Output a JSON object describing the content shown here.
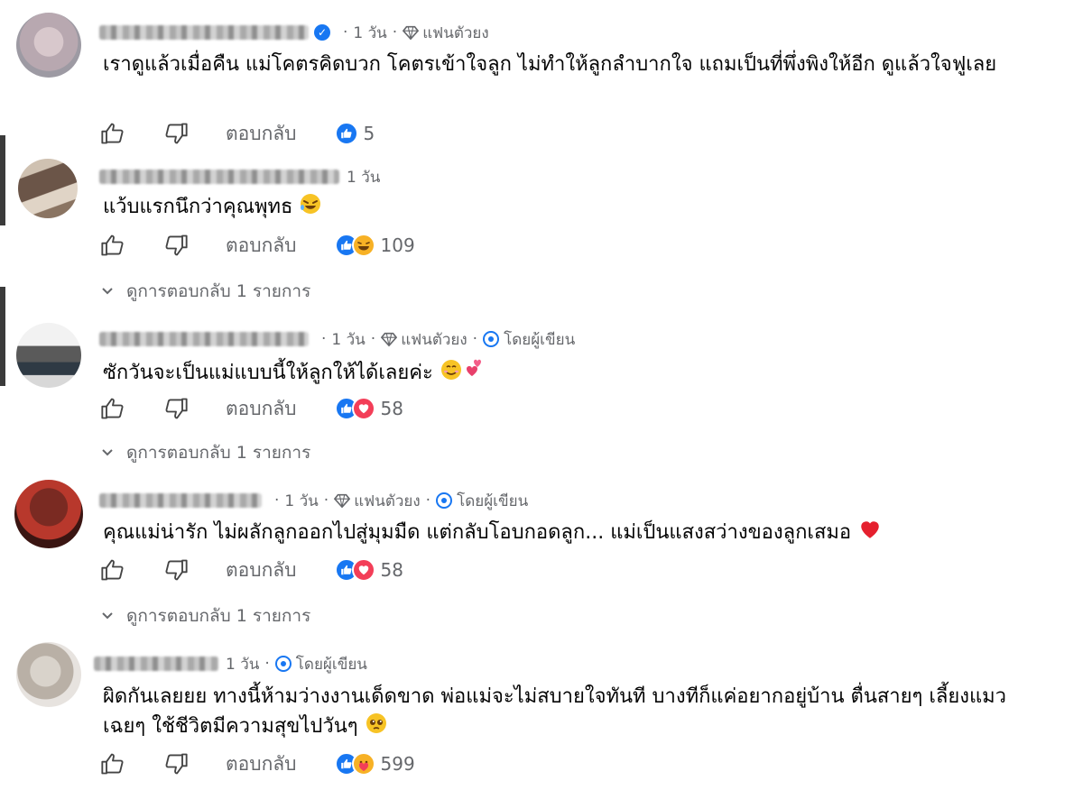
{
  "comments": [
    {
      "time": "1 วัน",
      "badge_label": "แฟนตัวยง",
      "verified": true,
      "author_label": "",
      "text": "เราดูแล้วเมื่อคืน แม่โคตรคิดบวก โคตรเข้าใจลูก ไม่ทำให้ลูกลำบากใจ แถมเป็นที่พึ่งพิงให้อีก ดูแล้วใจฟูเลย",
      "text_emoji": "",
      "reply_label": "ตอบกลับ",
      "reactions": [
        "like"
      ],
      "reaction_count": "5",
      "view_replies": ""
    },
    {
      "time": "1 วัน",
      "badge_label": "",
      "verified": false,
      "author_label": "",
      "text": "แว้บแรกนึกว่าคุณพุทธ",
      "text_emoji": "rofl-emoji",
      "reply_label": "ตอบกลับ",
      "reactions": [
        "like",
        "haha"
      ],
      "reaction_count": "109",
      "view_replies": "ดูการตอบกลับ 1 รายการ"
    },
    {
      "time": "1 วัน",
      "badge_label": "แฟนตัวยง",
      "verified": false,
      "author_label": "โดยผู้เขียน",
      "text": "ซักวันจะเป็นแม่แบบนี้ให้ลูกให้ได้เลยค่ะ",
      "text_emoji": "smile-hearts-emoji",
      "reply_label": "ตอบกลับ",
      "reactions": [
        "like",
        "love"
      ],
      "reaction_count": "58",
      "view_replies": "ดูการตอบกลับ 1 รายการ"
    },
    {
      "time": "1 วัน",
      "badge_label": "แฟนตัวยง",
      "verified": false,
      "author_label": "โดยผู้เขียน",
      "text": "คุณแม่น่ารัก ไม่ผลักลูกออกไปสู่มุมมืด แต่กลับโอบกอดลูก... แม่เป็นแสงสว่างของลูกเสมอ",
      "text_emoji": "red-heart-emoji",
      "reply_label": "ตอบกลับ",
      "reactions": [
        "like",
        "love"
      ],
      "reaction_count": "58",
      "view_replies": "ดูการตอบกลับ 1 รายการ"
    },
    {
      "time": "1 วัน",
      "badge_label": "",
      "verified": false,
      "author_label": "โดยผู้เขียน",
      "text": "ผิดกันเลยยย ทางนี้ห้ามว่างงานเด็ดขาด พ่อแม่จะไม่สบายใจทันที บางทีก็แค่อยากอยู่บ้าน ตื่นสายๆ เลี้ยงแมวเฉยๆ ใช้ชีวิตมีความสุขไปวันๆ",
      "text_emoji": "pleading-emoji",
      "reply_label": "ตอบกลับ",
      "reactions": [
        "like",
        "care"
      ],
      "reaction_count": "599",
      "view_replies": ""
    }
  ],
  "colors": {
    "text": "#050505",
    "secondary": "#65676b",
    "like_blue": "#1877f2",
    "love_red": "#f33e58",
    "haha_yellow": "#f7b125"
  }
}
